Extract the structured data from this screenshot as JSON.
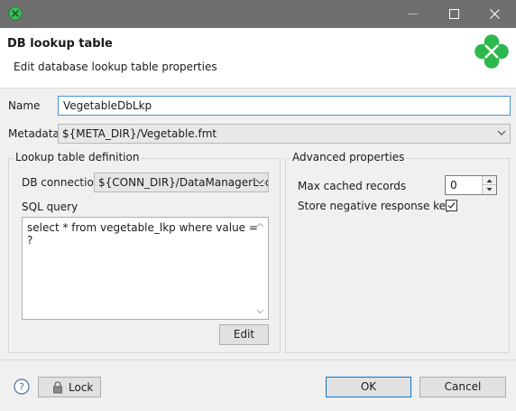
{
  "window": {
    "icon": "clover-icon",
    "controls": [
      "minimize-icon",
      "maximize-icon",
      "close-icon"
    ]
  },
  "header": {
    "title": "DB lookup table",
    "subtitle": "Edit database lookup table properties",
    "logo": "clover-logo-icon",
    "logo_color": "#2db84d"
  },
  "form": {
    "name_label": "Name",
    "name_value": "VegetableDbLkp",
    "metadata_label": "Metadata",
    "metadata_value": "${META_DIR}/Vegetable.fmt"
  },
  "definition": {
    "title": "Lookup table definition",
    "db_connection_label": "DB connection",
    "db_connection_value": "${CONN_DIR}/DataManagerLool",
    "sql_label": "SQL query",
    "sql_value": "select * from vegetable_lkp where value = ?",
    "edit_button": "Edit"
  },
  "advanced": {
    "title": "Advanced properties",
    "max_cached_label": "Max cached records",
    "max_cached_value": "0",
    "store_negative_label": "Store negative response key",
    "store_negative_checked": true
  },
  "footer": {
    "help_icon": "help-icon",
    "lock_icon": "lock-icon",
    "lock_button": "Lock",
    "ok_button": "OK",
    "cancel_button": "Cancel"
  },
  "colors": {
    "titlebar": "#6f6f6f",
    "focus_border": "#4a90d9",
    "default_button_border": "#0078d7"
  }
}
